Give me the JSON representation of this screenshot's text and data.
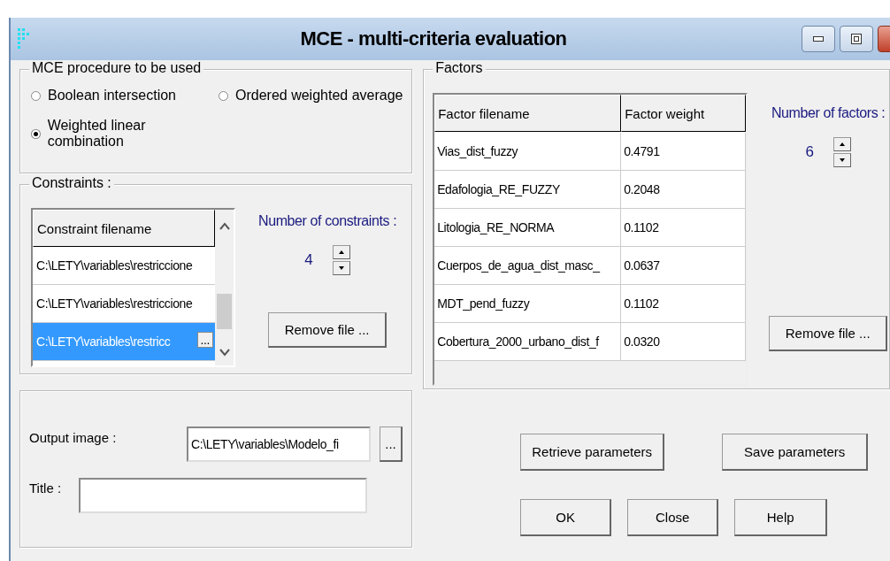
{
  "window": {
    "title": "MCE - multi-criteria evaluation"
  },
  "procedure": {
    "label": "MCE procedure to be used",
    "options": [
      {
        "label": "Boolean intersection",
        "selected": false
      },
      {
        "label": "Ordered weighted average",
        "selected": false
      },
      {
        "label": "Weighted linear combination",
        "selected": true
      }
    ]
  },
  "constraints": {
    "label": "Constraints :",
    "column": "Constraint filename",
    "rows": [
      {
        "filename": "C:\\LETY\\variables\\restriccione",
        "selected": false
      },
      {
        "filename": "C:\\LETY\\variables\\restriccione",
        "selected": false
      },
      {
        "filename": "C:\\LETY\\variables\\restricc",
        "selected": true,
        "browse": "..."
      }
    ],
    "count_label": "Number of constraints :",
    "count": "4",
    "remove_button": "Remove file ..."
  },
  "factors": {
    "label": "Factors",
    "columns": [
      "Factor filename",
      "Factor weight"
    ],
    "rows": [
      {
        "filename": "Vias_dist_fuzzy",
        "weight": "0.4791"
      },
      {
        "filename": "Edafologia_RE_FUZZY",
        "weight": "0.2048"
      },
      {
        "filename": "Litologia_RE_NORMA",
        "weight": "0.1102"
      },
      {
        "filename": "Cuerpos_de_agua_dist_masc_",
        "weight": "0.0637"
      },
      {
        "filename": "MDT_pend_fuzzy",
        "weight": "0.1102"
      },
      {
        "filename": "Cobertura_2000_urbano_dist_f",
        "weight": "0.0320"
      }
    ],
    "count_label": "Number of factors :",
    "count": "6",
    "remove_button": "Remove file ..."
  },
  "output": {
    "label": "Output image :",
    "value": "C:\\LETY\\variables\\Modelo_fi",
    "browse": "...",
    "title_label": "Title :"
  },
  "buttons": [
    "Retrieve parameters",
    "Save parameters",
    "OK",
    "Close",
    "Help"
  ]
}
